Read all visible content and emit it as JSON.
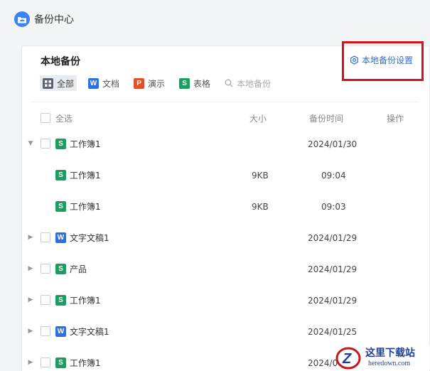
{
  "app": {
    "title": "备份中心"
  },
  "panel": {
    "title": "本地备份",
    "settings_label": "本地备份设置"
  },
  "filters": [
    {
      "label": "全部",
      "icon": "grid-icon",
      "active": true
    },
    {
      "label": "文档",
      "icon": "W"
    },
    {
      "label": "演示",
      "icon": "P"
    },
    {
      "label": "表格",
      "icon": "S"
    }
  ],
  "search": {
    "placeholder": "本地备份"
  },
  "table": {
    "select_all": "全选",
    "col_size": "大小",
    "col_time": "备份时间",
    "col_action": "操作"
  },
  "rows": [
    {
      "name": "工作簿1",
      "type": "S",
      "time": "2024/01/30",
      "expanded": true
    },
    {
      "name": "工作簿1",
      "type": "S",
      "size": "9KB",
      "time": "09:04",
      "child": true
    },
    {
      "name": "工作簿1",
      "type": "S",
      "size": "9KB",
      "time": "09:03",
      "child": true
    },
    {
      "name": "文字文稿1",
      "type": "W",
      "time": "2024/01/29"
    },
    {
      "name": "产品",
      "type": "S",
      "time": "2024/01/29"
    },
    {
      "name": "工作簿1",
      "type": "S",
      "time": "2024/01/29"
    },
    {
      "name": "文字文稿1",
      "type": "W",
      "time": "2024/01/25"
    },
    {
      "name": "工作簿1",
      "type": "S",
      "time": "2024/0"
    }
  ],
  "watermark": {
    "brand": "这里下载站",
    "domain": "heredown.com"
  },
  "colors": {
    "accent": "#2f6fd8",
    "highlight": "#d4141a",
    "word": "#2f6fe4",
    "sheet": "#1f9d61",
    "ppt": "#e0502c"
  }
}
